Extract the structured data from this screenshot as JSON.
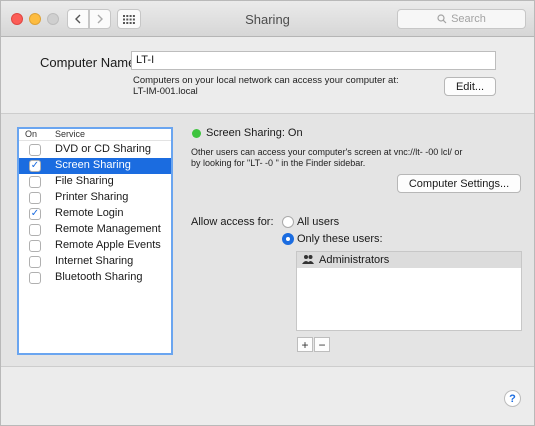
{
  "window": {
    "title": "Sharing",
    "search_placeholder": "Search",
    "icons": {
      "back": "chevron-left-icon",
      "forward": "chevron-right-icon",
      "grid": "grid-icon",
      "search": "search-icon"
    }
  },
  "computer_name": {
    "label": "Computer Name:",
    "value": "LT-I",
    "description_line1": "Computers on your local network can access your computer at:",
    "description_line2": "LT-IM-001.local",
    "edit_button": "Edit..."
  },
  "services": {
    "header_on": "On",
    "header_service": "Service",
    "items": [
      {
        "label": "DVD or CD Sharing",
        "checked": false,
        "selected": false
      },
      {
        "label": "Screen Sharing",
        "checked": true,
        "selected": true
      },
      {
        "label": "File Sharing",
        "checked": false,
        "selected": false
      },
      {
        "label": "Printer Sharing",
        "checked": false,
        "selected": false
      },
      {
        "label": "Remote Login",
        "checked": true,
        "selected": false
      },
      {
        "label": "Remote Management",
        "checked": false,
        "selected": false
      },
      {
        "label": "Remote Apple Events",
        "checked": false,
        "selected": false
      },
      {
        "label": "Internet Sharing",
        "checked": false,
        "selected": false
      },
      {
        "label": "Bluetooth Sharing",
        "checked": false,
        "selected": false
      }
    ]
  },
  "screen_sharing": {
    "status": "Screen Sharing: On",
    "status_color": "#3ec43e",
    "desc_line1": "Other users can access your computer's screen at vnc://lt-      -00         lcl/ or",
    "desc_line2": "by looking for \"LT-      -0      \" in the Finder sidebar.",
    "computer_settings_button": "Computer Settings...",
    "allow_label": "Allow access for:",
    "option_all": "All users",
    "option_only": "Only these users:",
    "selected_option": "only",
    "users": [
      "Administrators"
    ],
    "add_button": "+",
    "remove_button": "−"
  },
  "help": {
    "label": "?"
  },
  "colors": {
    "accent": "#1b6ce0",
    "focus_ring": "#6aa5f0"
  }
}
